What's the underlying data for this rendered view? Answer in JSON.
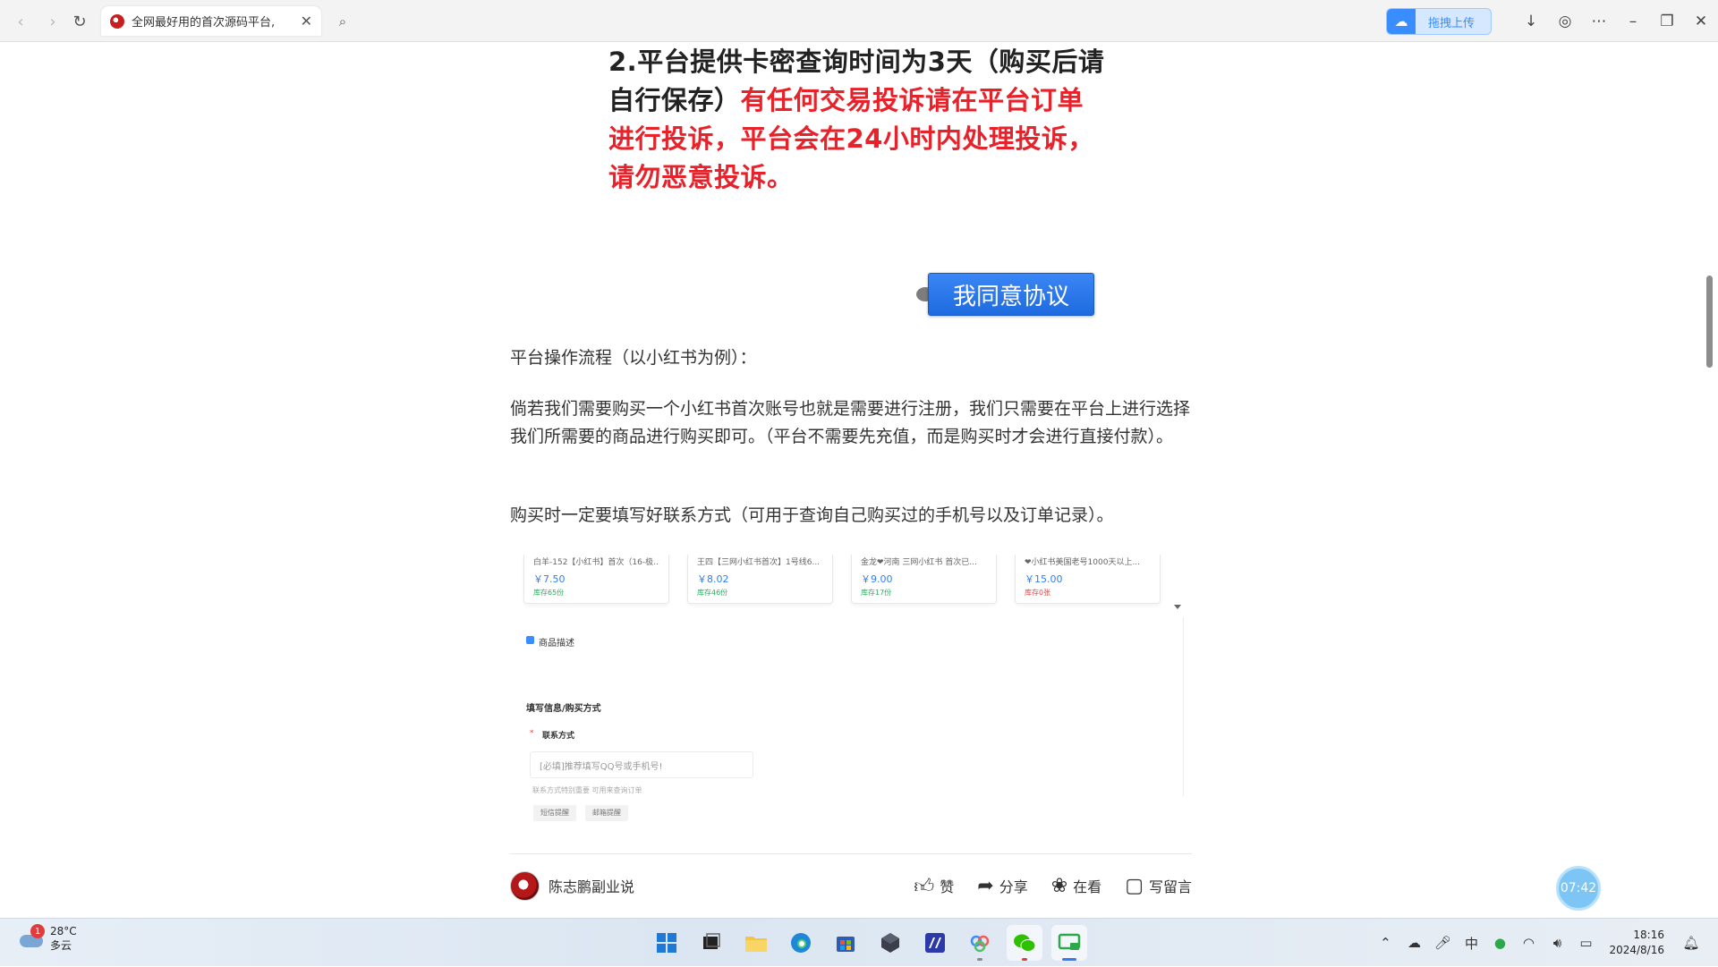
{
  "browser": {
    "tab_title": "全网最好用的首次源码平台,",
    "upload_label": "拖拽上传"
  },
  "article": {
    "notice_prefix": "2.平台提供卡密查询时间为3天（购买后请自行保存）",
    "notice_red": "有任何交易投诉请在平台订单进行投诉，平台会在24小时内处理投诉，请勿恶意投诉。",
    "agree_button": "我同意协议",
    "para1": "平台操作流程（以小红书为例）：",
    "para2": "倘若我们需要购买一个小红书首次账号也就是需要进行注册，我们只需要在平台上进行选择我们所需要的商品进行购买即可。（平台不需要先充值，而是购买时才会进行直接付款）。",
    "para3": "购买时一定要填写好联系方式（可用于查询自己购买过的手机号以及订单记录）。"
  },
  "embed": {
    "products": [
      {
        "name": "白羊-152【小红书】首次（16-极...",
        "price": "￥7.50",
        "stock": "库存65份"
      },
      {
        "name": "王四【三网小红书首次】1号线6...",
        "price": "￥8.02",
        "stock": "库存46份"
      },
      {
        "name": "金龙❤河南 三网小红书 首次已...",
        "price": "￥9.00",
        "stock": "库存17份"
      },
      {
        "name": "❤小红书美国老号1000天以上...",
        "price": "￥15.00",
        "stock": "库存0张"
      }
    ],
    "desc_title": "商品描述",
    "fill_title": "填写信息/购买方式",
    "contact_label": "联系方式",
    "input_placeholder": "[必填]推荐填写QQ号或手机号!",
    "hint": "联系方式特别重要 可用来查询订单",
    "chip1": "短信提醒",
    "chip2": "邮箱提醒"
  },
  "footer": {
    "author": "陈志鹏副业说",
    "like": "赞",
    "share": "分享",
    "watching": "在看",
    "comment": "写留言"
  },
  "timer": "07:42",
  "taskbar": {
    "weather_badge": "1",
    "temperature": "28°C",
    "weather_desc": "多云",
    "ime": "中",
    "time": "18:16",
    "date": "2024/8/16"
  }
}
